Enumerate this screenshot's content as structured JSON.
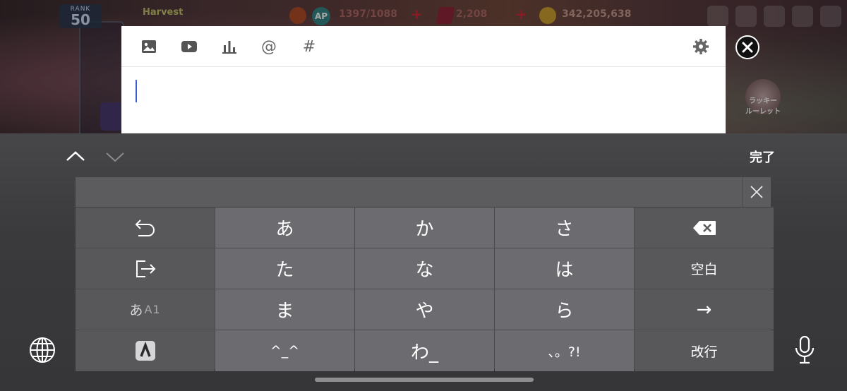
{
  "game_hud": {
    "rank_label": "RANK",
    "rank_value": "50",
    "guild_name": "Harvest",
    "ap_label": "AP",
    "ap_value": "1397/1088",
    "gems": "2,208",
    "coins": "342,205,638",
    "roulette_label": "ラッキー\nルーレット"
  },
  "composer": {
    "toolbar_icons": [
      "image-icon",
      "youtube-icon",
      "poll-icon",
      "mention-icon",
      "hashtag-icon",
      "gear-icon"
    ],
    "mention_symbol": "@",
    "hashtag_symbol": "#",
    "text_value": ""
  },
  "keyboard": {
    "done_label": "完了",
    "rows": [
      [
        "undo",
        "あ",
        "か",
        "さ",
        "delete"
      ],
      [
        "next-field",
        "た",
        "な",
        "は",
        "空白"
      ],
      [
        "あA1",
        "ま",
        "や",
        "ら",
        "→"
      ],
      [
        "stroke-mode",
        "^_^",
        "わ_",
        "、。?!",
        "改行"
      ]
    ],
    "mode_label_a": "あ",
    "mode_label_b": "A1",
    "space_label": "空白",
    "arrow_label": "→",
    "return_label": "改行",
    "kana_a": "あ",
    "kana_ka": "か",
    "kana_sa": "さ",
    "kana_ta": "た",
    "kana_na": "な",
    "kana_ha": "は",
    "kana_ma": "ま",
    "kana_ya": "や",
    "kana_ra": "ら",
    "emoticon": "^_^",
    "kana_wa": "わ_",
    "punct": "、。?!"
  },
  "colors": {
    "caret": "#3b5bd8",
    "key_main": "#6c6c70",
    "key_func": "#58585b",
    "candidate_bar": "#5c5c5f"
  }
}
